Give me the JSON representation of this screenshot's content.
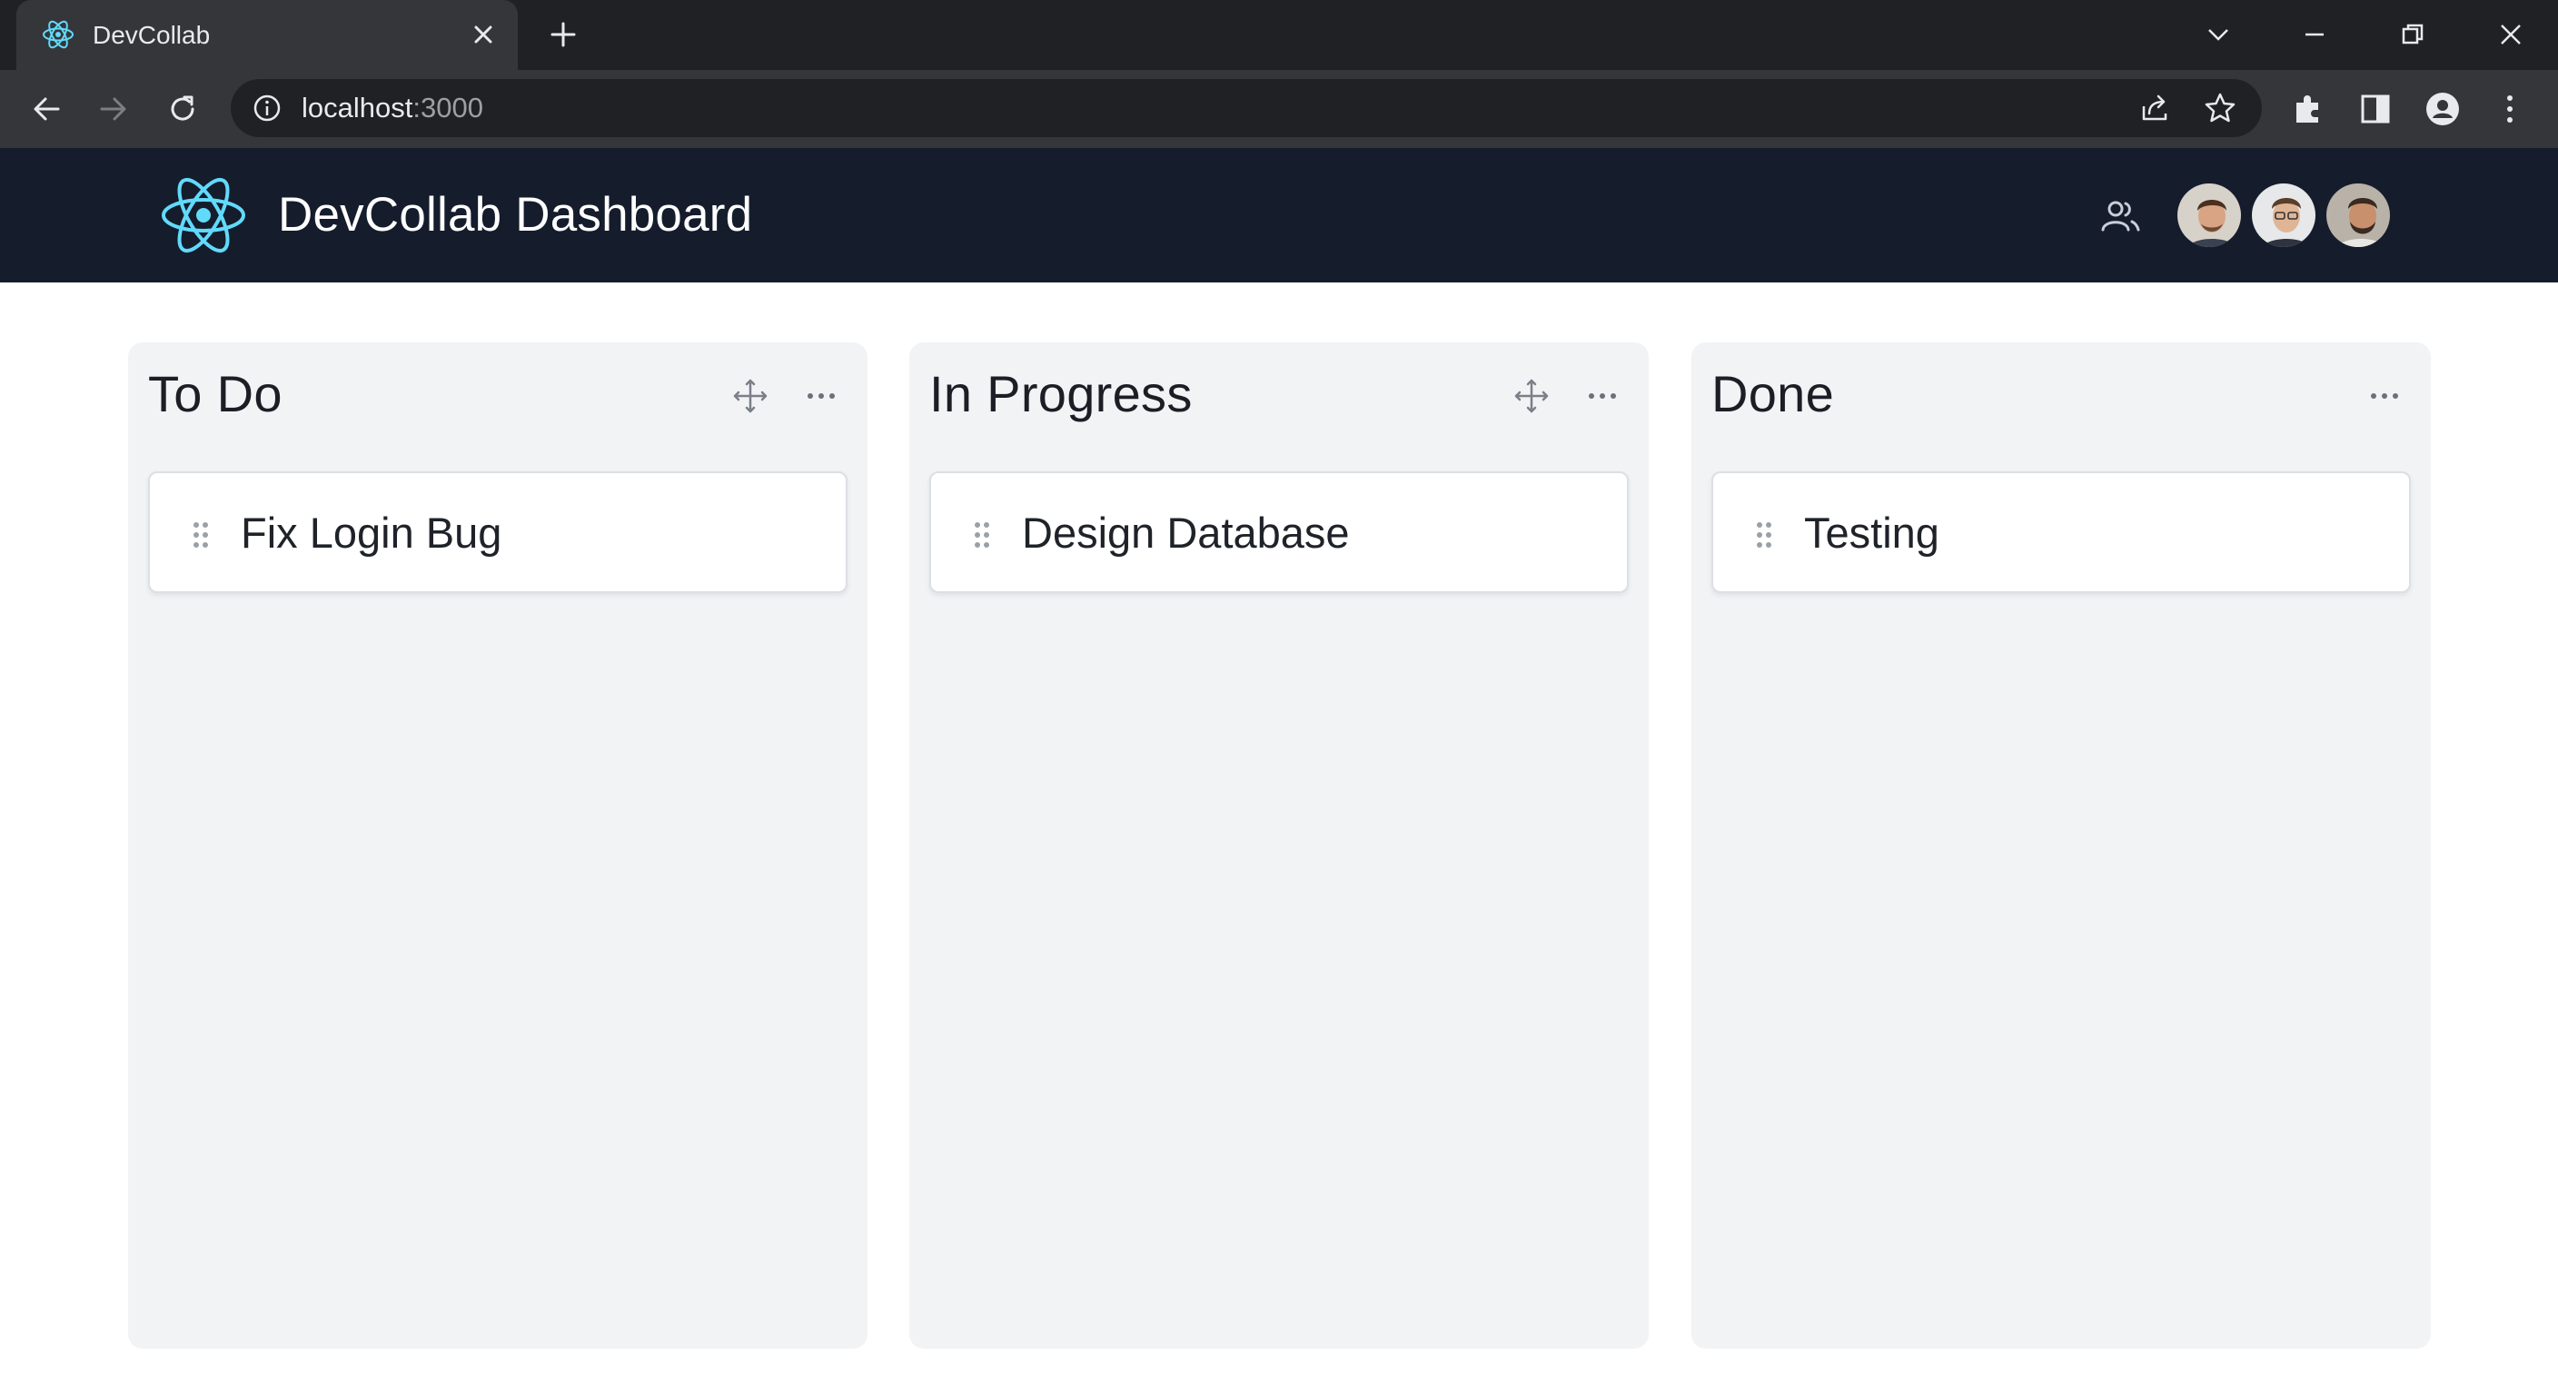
{
  "browser": {
    "tab_title": "DevCollab",
    "url_host": "localhost",
    "url_port": ":3000"
  },
  "app": {
    "title": "DevCollab Dashboard",
    "logo_icon": "react-atom-icon",
    "team_icon": "users-icon",
    "avatars": [
      "avatar-user-1",
      "avatar-user-2",
      "avatar-user-3"
    ]
  },
  "colors": {
    "header_bg": "#151c2c",
    "accent": "#61dafb",
    "column_bg": "#f1f3f5"
  },
  "board": {
    "columns": [
      {
        "title": "To Do",
        "cards": [
          "Fix Login Bug"
        ]
      },
      {
        "title": "In Progress",
        "cards": [
          "Design Database"
        ]
      },
      {
        "title": "Done",
        "cards": [
          "Testing"
        ]
      }
    ]
  }
}
